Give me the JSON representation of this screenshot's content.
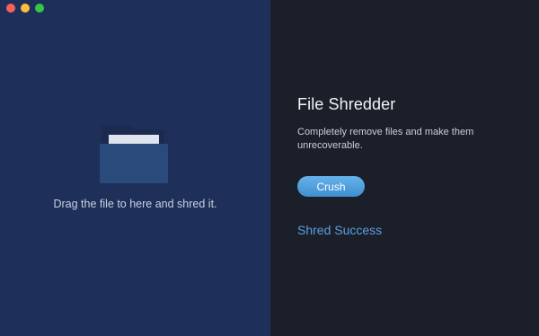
{
  "window": {
    "controls": [
      "close",
      "minimize",
      "maximize"
    ]
  },
  "left": {
    "drop_text": "Drag the file to here and shred it.",
    "icon": "folder-icon"
  },
  "right": {
    "title": "File Shredder",
    "description": "Completely remove files and make them unrecoverable.",
    "crush_label": "Crush",
    "success_link": "Shred Success"
  },
  "colors": {
    "left_bg": "#1e3059",
    "right_bg": "#1b1f2a",
    "accent": "#4f9fe0",
    "link": "#5d9fe0"
  }
}
